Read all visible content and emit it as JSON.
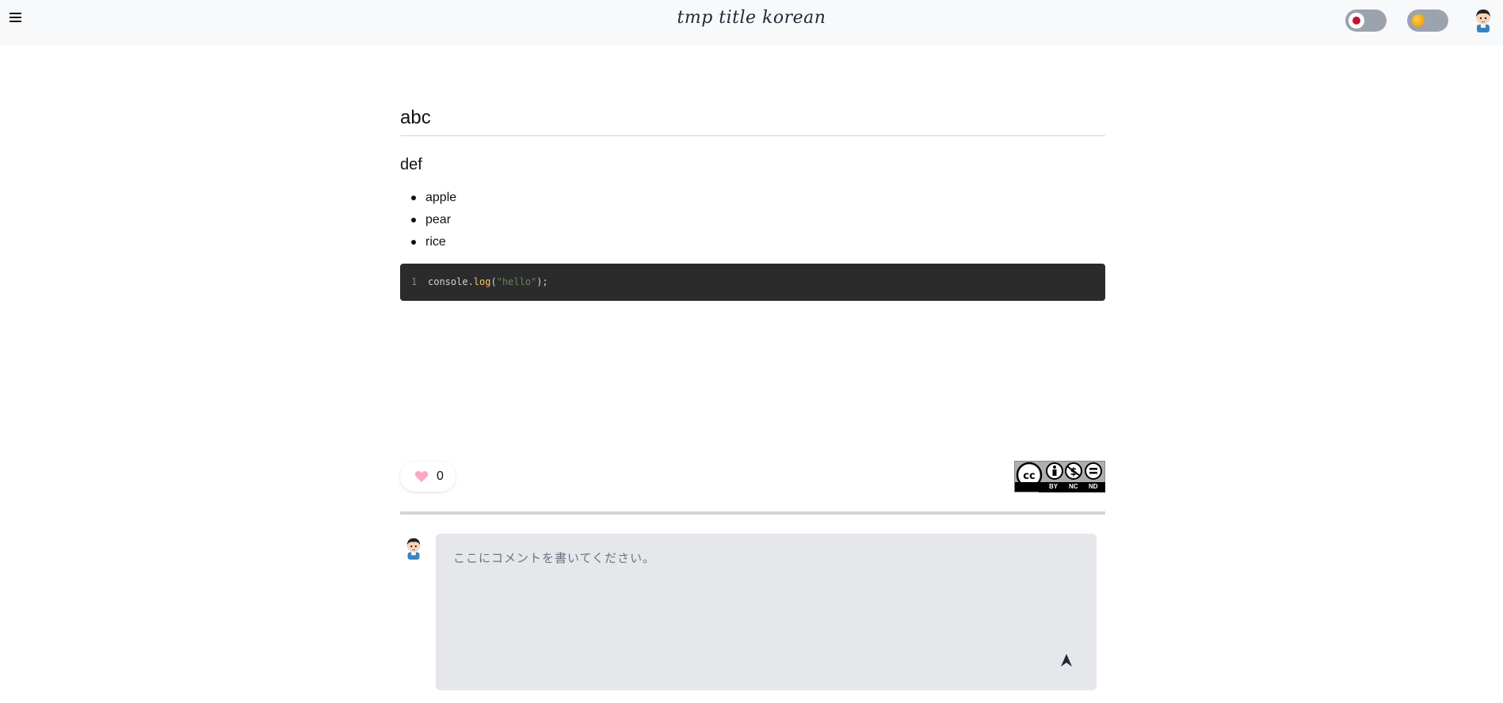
{
  "header": {
    "title": "tmp title korean",
    "menu_icon": "hamburger-menu-icon",
    "toggle_1": {
      "state": "off",
      "indicator_color": "#c8102e"
    },
    "toggle_2": {
      "state": "off",
      "indicator": "sun-icon"
    },
    "avatar_icon": "user-avatar-icon"
  },
  "post": {
    "heading": "abc",
    "subheading": "def",
    "list_items": [
      "apple",
      "pear",
      "rice"
    ],
    "code": {
      "line_number": "1",
      "tokens": {
        "obj": "console.",
        "fn": "log",
        "open": "(",
        "str": "\"hello\"",
        "close": ");"
      }
    }
  },
  "like": {
    "count": "0",
    "icon": "heart-icon",
    "color": "#f9a8c0"
  },
  "license": {
    "labels": [
      "BY",
      "NC",
      "ND"
    ],
    "icon": "creative-commons-icon"
  },
  "comment": {
    "placeholder": "ここにコメントを書いてください。",
    "send_icon": "send-icon"
  },
  "colors": {
    "topbar_bg": "#f8f9fa",
    "code_bg": "#2b2b2b",
    "comment_bg": "#e5e7eb",
    "toggle_bg": "#9ca3af"
  }
}
